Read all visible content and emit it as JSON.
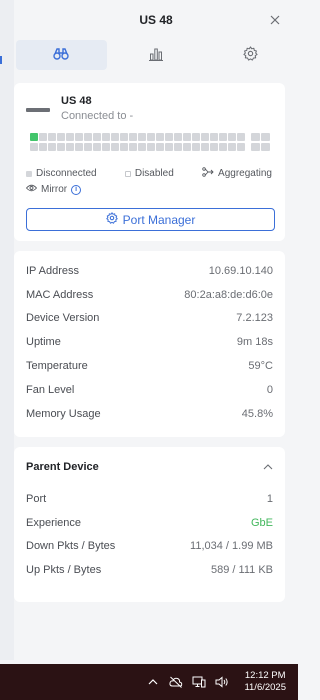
{
  "header": {
    "title": "US 48"
  },
  "tabs": [
    {
      "name": "overview",
      "icon": "binoculars-icon",
      "active": true
    },
    {
      "name": "statistics",
      "icon": "bar-chart-icon",
      "active": false
    },
    {
      "name": "settings",
      "icon": "gear-icon",
      "active": false
    }
  ],
  "device": {
    "name": "US 48",
    "status": "Connected to -",
    "ports_total": 48,
    "ports_up": [
      1
    ],
    "sfp_total": 4,
    "legend": {
      "disconnected": "Disconnected",
      "disabled": "Disabled",
      "aggregating": "Aggregating",
      "mirror": "Mirror"
    },
    "port_manager_label": "Port Manager"
  },
  "info": [
    {
      "key": "IP Address",
      "value": "10.69.10.140"
    },
    {
      "key": "MAC Address",
      "value": "80:2a:a8:de:d6:0e"
    },
    {
      "key": "Device Version",
      "value": "7.2.123"
    },
    {
      "key": "Uptime",
      "value": "9m 18s"
    },
    {
      "key": "Temperature",
      "value": "59°C"
    },
    {
      "key": "Fan Level",
      "value": "0"
    },
    {
      "key": "Memory Usage",
      "value": "45.8%"
    }
  ],
  "parent": {
    "title": "Parent Device",
    "rows": [
      {
        "key": "Port",
        "value": "1"
      },
      {
        "key": "Experience",
        "value": "GbE"
      },
      {
        "key": "Down Pkts / Bytes",
        "value": "11,034 / 1.99 MB"
      },
      {
        "key": "Up Pkts / Bytes",
        "value": "589 / 111 KB"
      }
    ]
  },
  "colors": {
    "accent": "#3b6fd8",
    "port_up": "#42c56b",
    "experience": "#42b75c",
    "taskbar": "#2b1214"
  },
  "taskbar": {
    "time": "12:12 PM",
    "date": "11/6/2025"
  }
}
